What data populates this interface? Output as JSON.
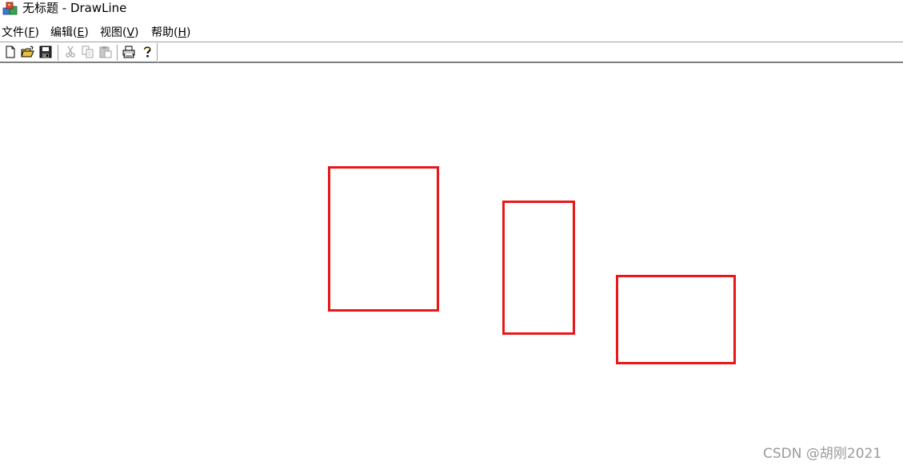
{
  "window": {
    "title": "无标题 - DrawLine",
    "app_icon": "mfc-app-icon"
  },
  "menu": {
    "file": {
      "label": "文件(",
      "accel": "F",
      "close": ")"
    },
    "edit": {
      "label": "编辑(",
      "accel": "E",
      "close": ")"
    },
    "view": {
      "label": "视图(",
      "accel": "V",
      "close": ")"
    },
    "help": {
      "label": "帮助(",
      "accel": "H",
      "close": ")"
    }
  },
  "toolbar": {
    "buttons": [
      {
        "icon": "new-file-icon",
        "enabled": true
      },
      {
        "icon": "open-folder-icon",
        "enabled": true
      },
      {
        "icon": "save-disk-icon",
        "enabled": true
      },
      {
        "icon": "cut-scissors-icon",
        "enabled": false
      },
      {
        "icon": "copy-icon",
        "enabled": false
      },
      {
        "icon": "paste-icon",
        "enabled": false
      },
      {
        "icon": "print-icon",
        "enabled": true
      },
      {
        "icon": "help-question-icon",
        "enabled": true
      }
    ]
  },
  "drawing": {
    "stroke_color": "#e81818",
    "rectangle_count": 3
  },
  "watermark": "CSDN @胡刚2021"
}
